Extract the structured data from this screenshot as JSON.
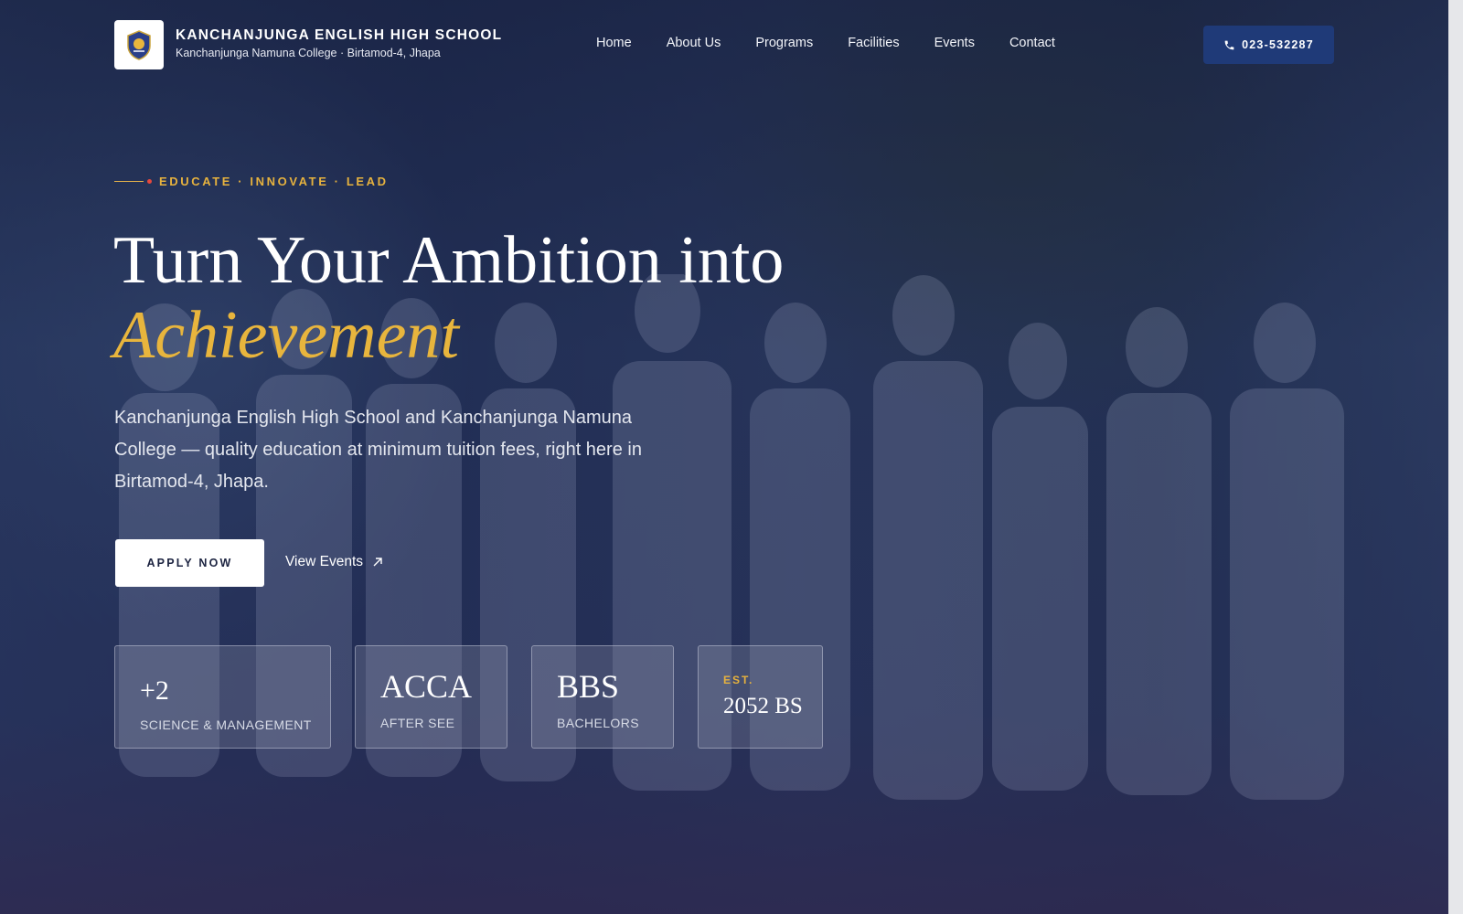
{
  "header": {
    "title": "KANCHANJUNGA ENGLISH HIGH SCHOOL",
    "subtitle": "Kanchanjunga Namuna College · Birtamod-4, Jhapa",
    "logo_icon": "school-crest-icon"
  },
  "nav": {
    "items": [
      "Home",
      "About Us",
      "Programs",
      "Facilities",
      "Events",
      "Contact"
    ]
  },
  "phone": {
    "label": "023-532287",
    "icon": "phone-icon"
  },
  "hero": {
    "tagline": "EDUCATE · INNOVATE · LEAD",
    "headline_line1": "Turn Your Ambition into",
    "headline_accent": "Achievement",
    "lead": "Kanchanjunga English High School and Kanchanjunga Namuna College — quality education at minimum tuition fees, right here in Birtamod-4, Jhapa.",
    "apply_label": "APPLY NOW",
    "events_label": "View Events",
    "events_icon": "arrow-up-right-icon"
  },
  "stats": [
    {
      "big": "+2",
      "small": "SCIENCE & MANAGEMENT"
    },
    {
      "big": "ACCA",
      "small": "AFTER SEE"
    },
    {
      "big": "BBS",
      "small": "BACHELORS"
    },
    {
      "est": "EST.",
      "year": "2052 BS"
    }
  ],
  "colors": {
    "accent_gold": "#e8b53d",
    "phone_button": "#1f3a78",
    "overlay_navy": "#1c2648"
  }
}
